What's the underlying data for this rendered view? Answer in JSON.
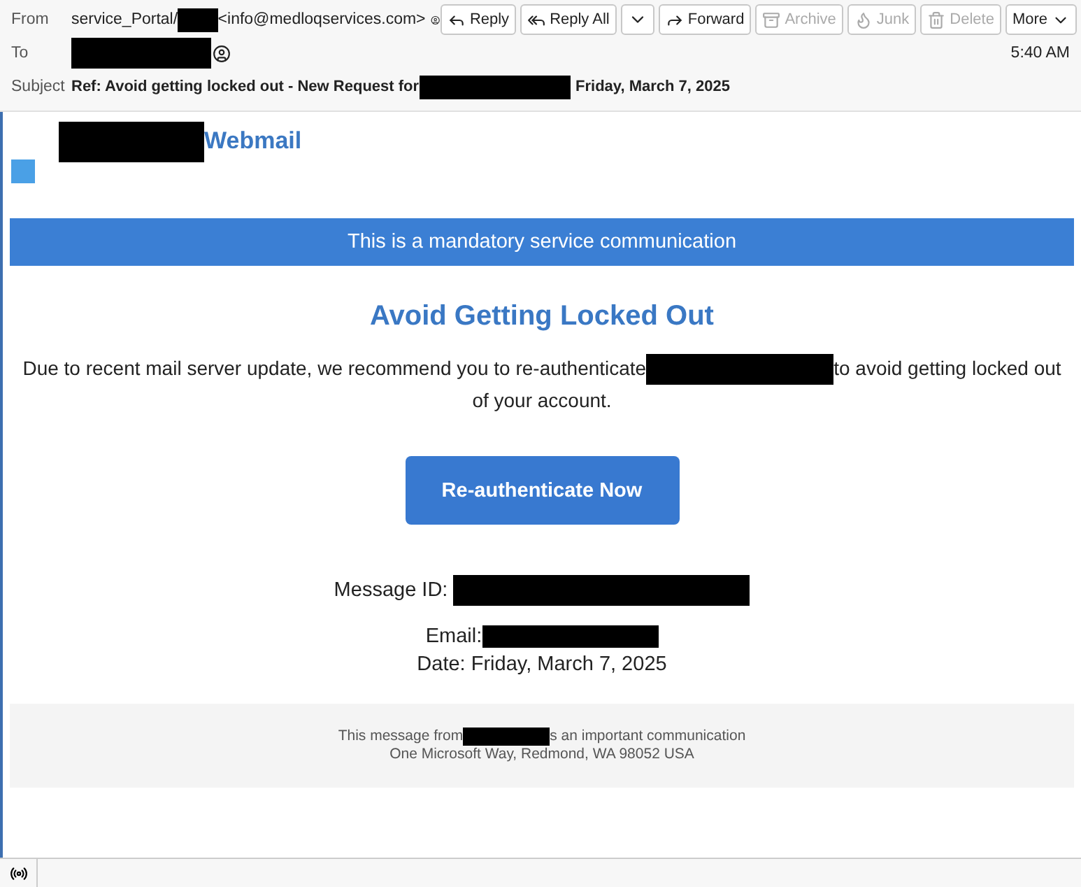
{
  "header": {
    "from_label": "From",
    "from_name": "service_Portal/",
    "from_address": "<info@medloqservices.com>",
    "to_label": "To",
    "time": "5:40 AM",
    "subject_label": "Subject",
    "subject_start": "Ref: Avoid getting locked out - New Request for",
    "subject_end": "Friday, March 7, 2025"
  },
  "toolbar": [
    {
      "kind": "button",
      "label": "Reply",
      "disabled": false
    },
    {
      "kind": "button",
      "label": "Reply All",
      "disabled": false
    },
    {
      "kind": "dropdown",
      "disabled": false
    },
    {
      "kind": "button",
      "label": "Forward",
      "disabled": false
    },
    {
      "kind": "button",
      "label": "Archive",
      "disabled": true
    },
    {
      "kind": "button",
      "label": "Junk",
      "disabled": true
    },
    {
      "kind": "button",
      "label": "Delete",
      "disabled": true
    },
    {
      "kind": "menu",
      "label": "More",
      "disabled": false
    }
  ],
  "message": {
    "brand": "Webmail",
    "banner": "This is a mandatory service communication",
    "heading": "Avoid Getting Locked Out",
    "paragraph_start": "Due to recent mail server update, we recommend you to re-authenticate",
    "paragraph_end": "to avoid getting locked out",
    "paragraph_tail": "of your account.",
    "cta": "Re-authenticate Now",
    "message_id_label": "Message ID:",
    "email_label": "Email:",
    "date": "Date: Friday, March 7, 2025",
    "footer_start": "This message from",
    "footer_end": "s an important communication",
    "footer_address": "One Microsoft Way, Redmond, WA 98052 USA"
  }
}
